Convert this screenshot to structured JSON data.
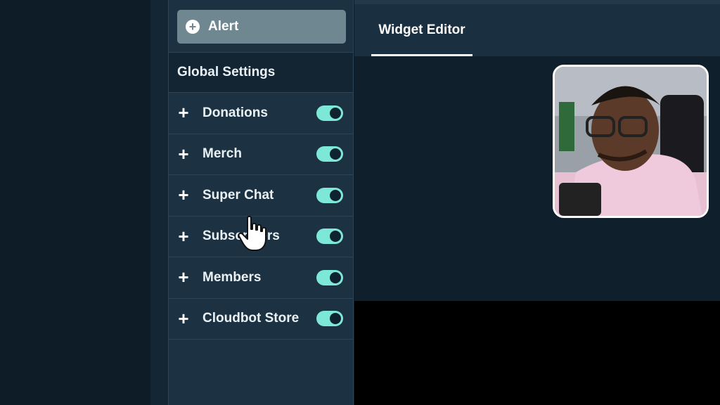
{
  "sidebar": {
    "alert_label": "Alert",
    "global_settings": "Global Settings",
    "items": [
      {
        "label": "Donations",
        "enabled": true
      },
      {
        "label": "Merch",
        "enabled": true
      },
      {
        "label": "Super Chat",
        "enabled": true
      },
      {
        "label": "Subscribers",
        "enabled": true
      },
      {
        "label": "Members",
        "enabled": true
      },
      {
        "label": "Cloudbot Store",
        "enabled": true
      }
    ]
  },
  "editor": {
    "tab_label": "Widget Editor"
  },
  "colors": {
    "toggle_on": "#7ee8d8",
    "panel_bg": "#1c3142",
    "alert_button": "#6f8791"
  }
}
